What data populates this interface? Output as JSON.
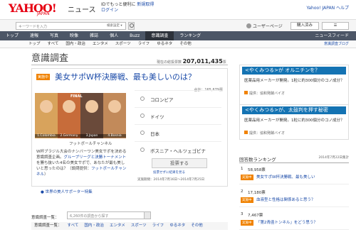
{
  "header": {
    "logo": "YAHOO!",
    "logo_sub": "JAPAN",
    "section": "ニュース",
    "promo_line": "IDでもっと便利に",
    "promo_register": "新規取得",
    "promo_login": "ログイン",
    "links": "Yahoo! JAPAN  ヘルプ"
  },
  "search": {
    "placeholder": "キーワードを入力",
    "category": "検索設定 ▾",
    "user_register": "ユーザーページ",
    "buy_button": "購入済み",
    "cart": "☰"
  },
  "nav": {
    "items": [
      "トップ",
      "速報",
      "写真",
      "映像",
      "雑誌",
      "個人",
      "Buzz",
      "意識調査",
      "ランキング"
    ],
    "right": "ニュースフィード"
  },
  "subnav": {
    "items": [
      "トップ",
      "すべて",
      "国内・政治",
      "エンタメ",
      "スポーツ",
      "ライフ",
      "ゆるネタ",
      "その他"
    ],
    "right": "意識調査ブログ"
  },
  "page": {
    "title": "意識調査",
    "total_label": "現在の総投票数",
    "total_value": "207,011,435",
    "total_unit": "票"
  },
  "survey": {
    "badge": "実施中",
    "title": "美女サポW杯決勝戦、最も美しいのは？",
    "total": "合計：165,679票",
    "photo_final": "FINAL",
    "photo_labels": [
      "1.Colombia",
      "2.Germany",
      "3.Japan",
      "4.Bosnia"
    ],
    "credit": "フットボールチャンネル",
    "desc_1": "W杯ブラジル大会のナンバーワン美女サポを決める意識調査企画。",
    "desc_link_1": "グループリーグと決勝トーナメント",
    "desc_2": "を勝ち抜いた4名の美女サポで、あなたが最も美しいと思ったのは？（設問提供：",
    "desc_link_2": "フットボールチャンネル",
    "desc_3": "）",
    "feature_link": "世界の美人サポーター特集",
    "options": [
      "コロンビア",
      "ドイツ",
      "日本",
      "ボスニア・ヘルツェゴビナ"
    ],
    "vote_button": "投票する",
    "vote_note": "投票せずに結果を見る",
    "period": "実施期間：2014年7月16日〜2014年7月25日"
  },
  "site_search": {
    "label": "意識調査一覧：",
    "placeholder": "6,260件の調査から探す",
    "categories_head": "意識調査一覧：",
    "categories": [
      "すべて",
      "国内・政治",
      "エンタメ",
      "スポーツ",
      "ライフ",
      "ゆるネタ",
      "その他"
    ]
  },
  "ads": [
    {
      "title": "<やくみつる>が オルニチンを？",
      "text": "医薬品用メーカーが開発。1粒に約300個分のコノ成分？",
      "provider": "提供：協和発酵バイオ"
    },
    {
      "title": "<やくみつる>が、太鼓判を押す秘密",
      "text": "医薬品用メーカーが開発。1粒に約300個分のコノ成分？",
      "provider": "提供：協和発酵バイオ"
    }
  ],
  "ranking": {
    "title": "回答数ランキング",
    "date": "2014年7月22日集計",
    "items": [
      {
        "rank": "1",
        "votes": "58,958票",
        "tag": "実施中",
        "title": "美女サポW杯決勝戦、最も美しい"
      },
      {
        "rank": "2",
        "votes": "17,180票",
        "tag": "実施中",
        "title": "血液型と性格は関係あると思う？"
      },
      {
        "rank": "3",
        "votes": "7,467票",
        "tag": "実施中",
        "title": "「第2青函トンネル」をどう思う？"
      }
    ]
  }
}
